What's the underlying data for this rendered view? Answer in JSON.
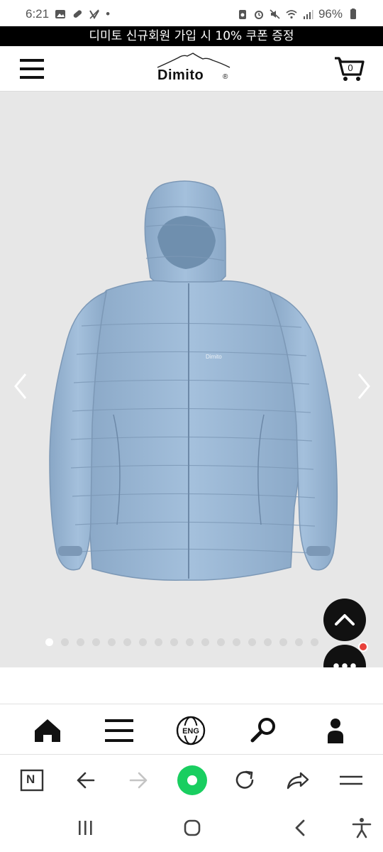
{
  "status_bar": {
    "time": "6:21",
    "dot": "•",
    "battery_percent": "96%",
    "left_icons": [
      "gallery-icon",
      "pill-icon",
      "no-volte-icon"
    ],
    "right_icons": [
      "alarm-app-icon",
      "alarm-clock-icon",
      "mute-icon",
      "wifi-icon",
      "signal-icon",
      "battery-icon"
    ]
  },
  "promo_banner": {
    "text": "디미토 신규회원 가입 시 10% 쿠폰 증정"
  },
  "header": {
    "logo_text": "Dimito",
    "logo_registered": "®",
    "cart_count": "0"
  },
  "gallery": {
    "product": "light blue hooded puffer jacket",
    "product_chest_print": "Dimito",
    "background_color": "#e7e7e7",
    "jacket_color": "#9db9d6",
    "dot_count": 18,
    "active_dot": 0
  },
  "floating": {
    "scroll_top_icon": "chevron-up-icon",
    "chat_icon": "chat-dots-icon",
    "chat_badge_color": "#e8413b"
  },
  "site_nav": {
    "items": [
      {
        "icon": "home-icon"
      },
      {
        "icon": "menu-icon"
      },
      {
        "icon": "language-globe-icon",
        "label": "ENG"
      },
      {
        "icon": "search-icon"
      },
      {
        "icon": "user-icon"
      }
    ]
  },
  "browser_toolbar": {
    "items": [
      "naver-n-icon",
      "back-arrow-icon",
      "forward-arrow-icon",
      "green-dot-icon",
      "refresh-icon",
      "share-icon",
      "more-menu-icon"
    ],
    "n_label": "N",
    "accent_color": "#19ce60"
  },
  "android_nav": {
    "items": [
      "recents-icon",
      "home-circle-icon",
      "back-chevron-icon",
      "accessibility-icon"
    ]
  }
}
